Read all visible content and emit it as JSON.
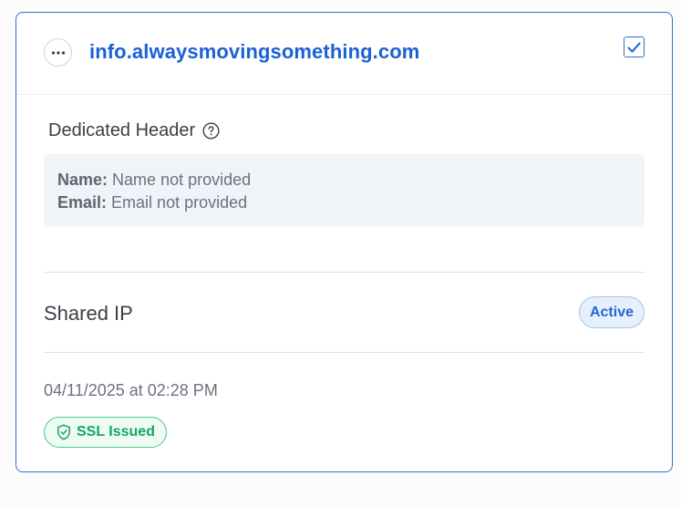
{
  "header": {
    "domain": "info.alwaysmovingsomething.com",
    "more_icon": "more-horizontal-icon",
    "checkbox_checked": true,
    "accent_color": "#2f6fd6"
  },
  "dedicated_header": {
    "title": "Dedicated Header",
    "help_icon": "question-circle-icon",
    "name_key": "Name:",
    "name_value": "Name not provided",
    "email_key": "Email:",
    "email_value": "Email not provided"
  },
  "ip": {
    "label": "Shared IP",
    "status": "Active",
    "status_color": "#2566d6"
  },
  "footer": {
    "timestamp": "04/11/2025 at 02:28 PM",
    "ssl_label": "SSL Issued",
    "ssl_icon": "shield-check-icon",
    "ssl_color": "#1aa45f"
  }
}
